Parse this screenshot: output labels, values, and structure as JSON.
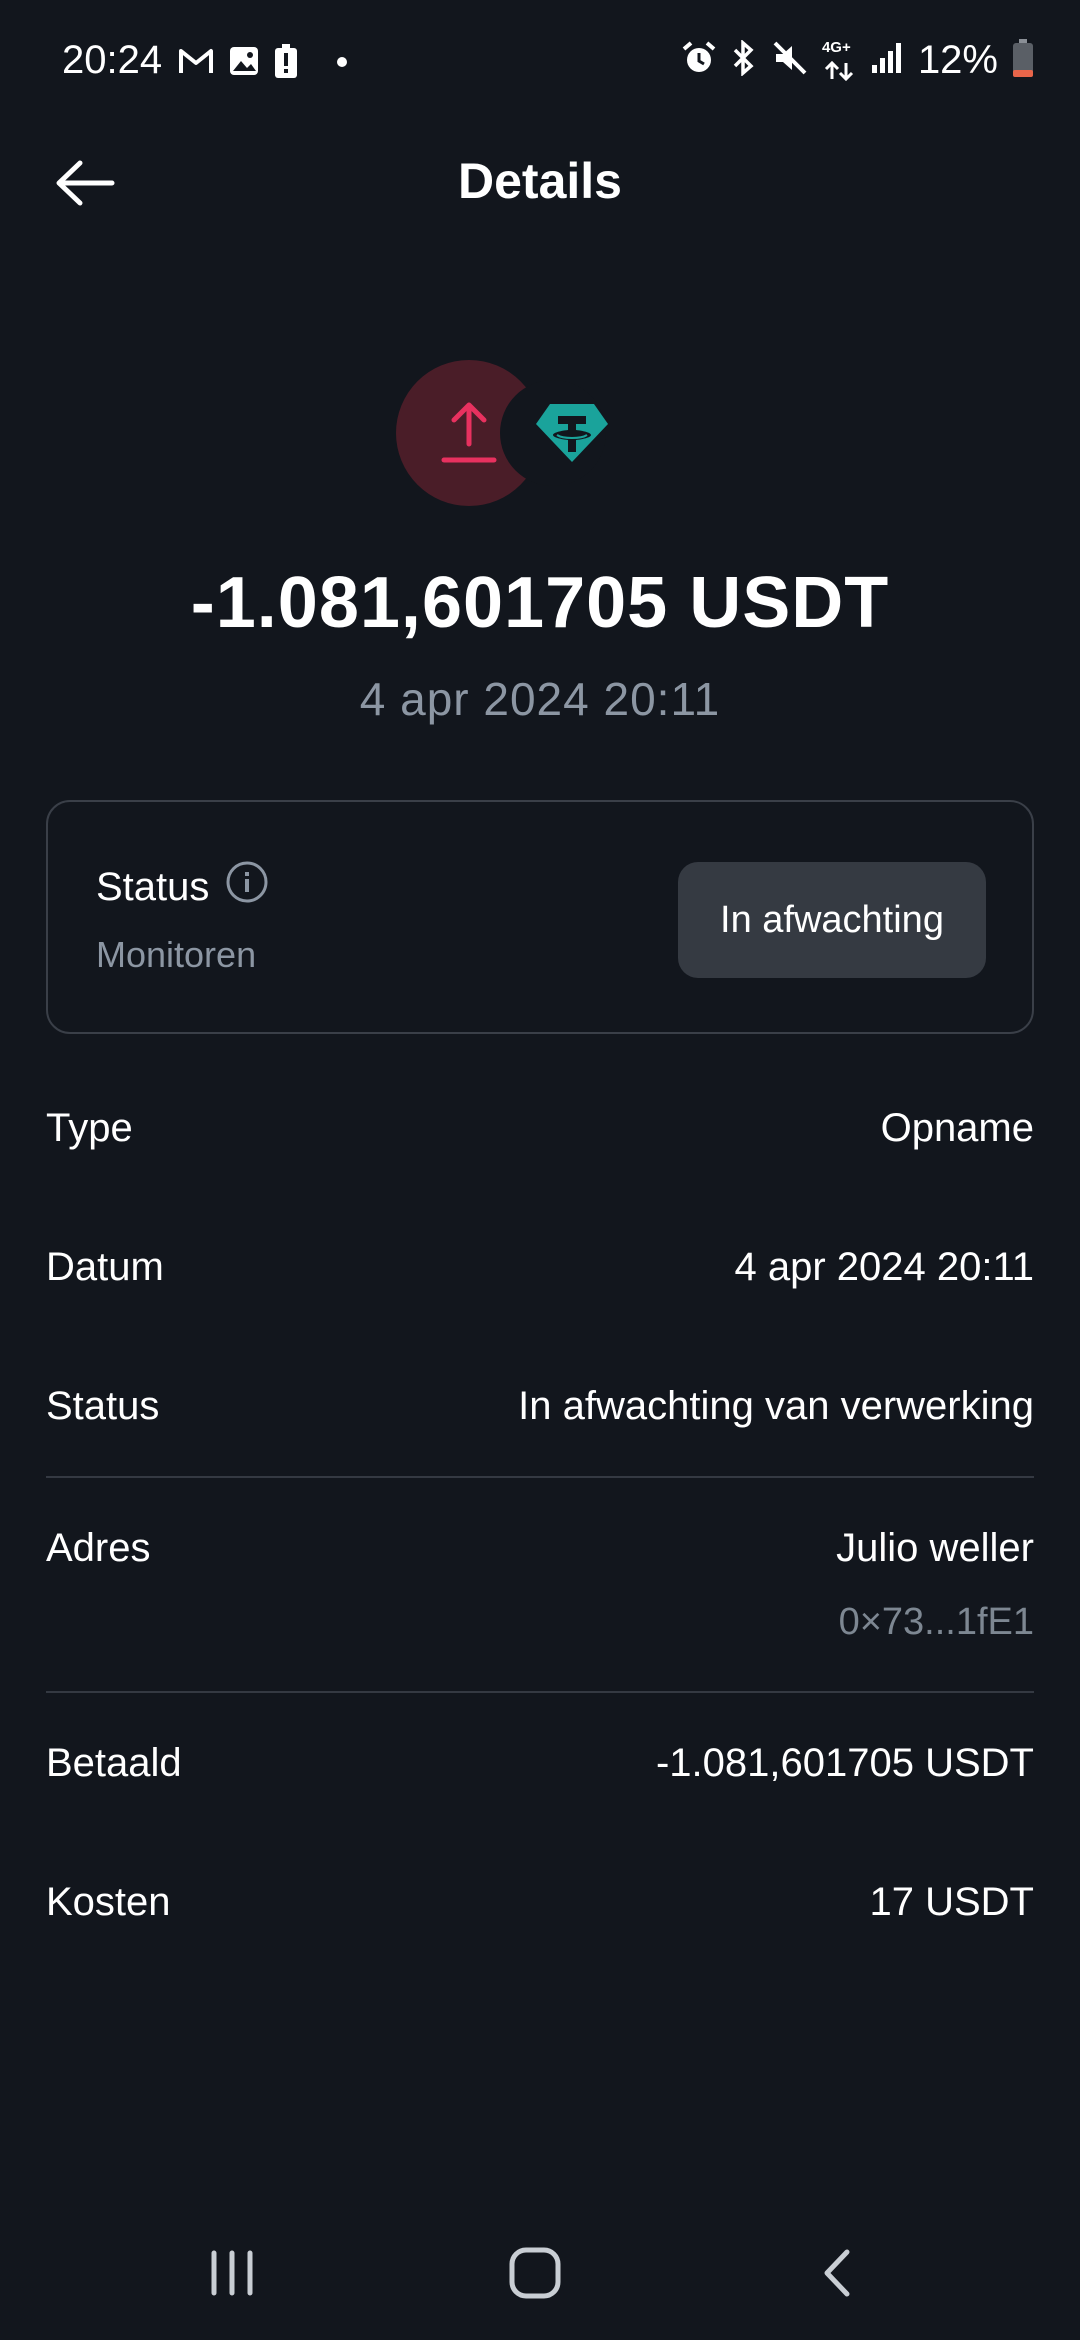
{
  "status_bar": {
    "time": "20:24",
    "battery": "12%",
    "left_icons": [
      "gmail-icon",
      "gallery-icon",
      "battery-alert-icon",
      "dot-icon"
    ],
    "right_icons": [
      "alarm-icon",
      "bluetooth-icon",
      "mute-icon",
      "4g-icon",
      "signal-icon",
      "battery-icon"
    ],
    "network_label": "4G+"
  },
  "header": {
    "title": "Details",
    "back_icon": "arrow-left-icon"
  },
  "hero": {
    "amount": "-1.081,601705 USDT",
    "date": "4 apr 2024 20:11",
    "direction_icon": "upload-arrow-icon",
    "coin_icon": "tether-icon",
    "colors": {
      "withdraw_bg": "#4a1d28",
      "withdraw_fg": "#e8315f",
      "tether": "#1aa39b"
    }
  },
  "status_card": {
    "label": "Status",
    "sublabel": "Monitoren",
    "badge": "In afwachting",
    "info_icon": "info-icon"
  },
  "details": {
    "type_label": "Type",
    "type_value": "Opname",
    "date_label": "Datum",
    "date_value": "4 apr 2024 20:11",
    "status_label": "Status",
    "status_value": "In afwachting van verwerking",
    "address_label": "Adres",
    "address_name": "Julio weller",
    "address_short": "0×73...1fE1",
    "paid_label": "Betaald",
    "paid_value": "-1.081,601705 USDT",
    "fee_label": "Kosten",
    "fee_value": "17 USDT"
  },
  "nav": {
    "recents_icon": "recents-icon",
    "home_icon": "home-icon",
    "back_icon": "back-icon"
  }
}
